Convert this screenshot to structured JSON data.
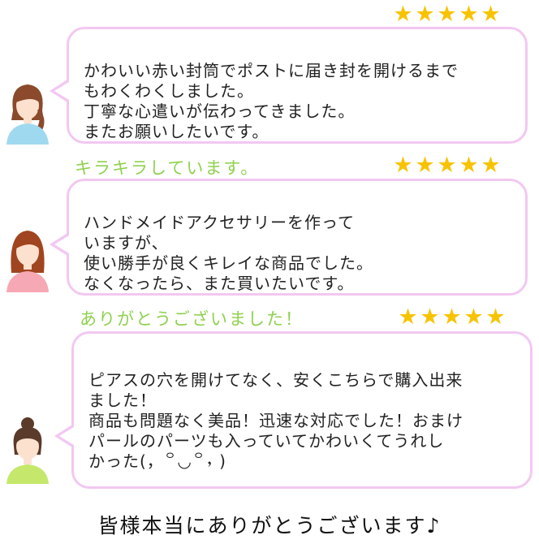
{
  "reviews": [
    {
      "heading": "",
      "stars": "★★★★★",
      "lines": [
        "かわいい赤い封筒でポストに届き封を開けるまで",
        "もわくわくしました。",
        "丁寧な心遣いが伝わってきました。",
        "またお願いしたいです。"
      ],
      "shirt_color": "#9fd9ef",
      "hair_color": "#8a4a2b"
    },
    {
      "heading": "キラキラしています。",
      "stars": "★★★★★",
      "lines": [
        "ハンドメイドアクセサリーを作って",
        "いますが、",
        "使い勝手が良くキレイな商品でした。",
        "なくなったら、また買いたいです。"
      ],
      "shirt_color": "#f7a8b5",
      "hair_color": "#a0451f"
    },
    {
      "heading": "ありがとうございました！",
      "stars": "★★★★★",
      "lines": [
        "ピアスの穴を開けてなく、安くこちらで購入出来",
        "ました！",
        "商品も問題なく美品！迅速な対応でした！おまけ",
        "パールのパーツも入っていてかわいくてうれし",
        "かった(，꒪◡꒪，)"
      ],
      "shirt_color": "#c5e86c",
      "hair_color": "#5a3a2a"
    }
  ],
  "footer": "皆様本当にありがとうございます♪",
  "colors": {
    "star": "#f7c300",
    "bubble_border": "#f2c8f1",
    "heading": "#8fd14f"
  }
}
